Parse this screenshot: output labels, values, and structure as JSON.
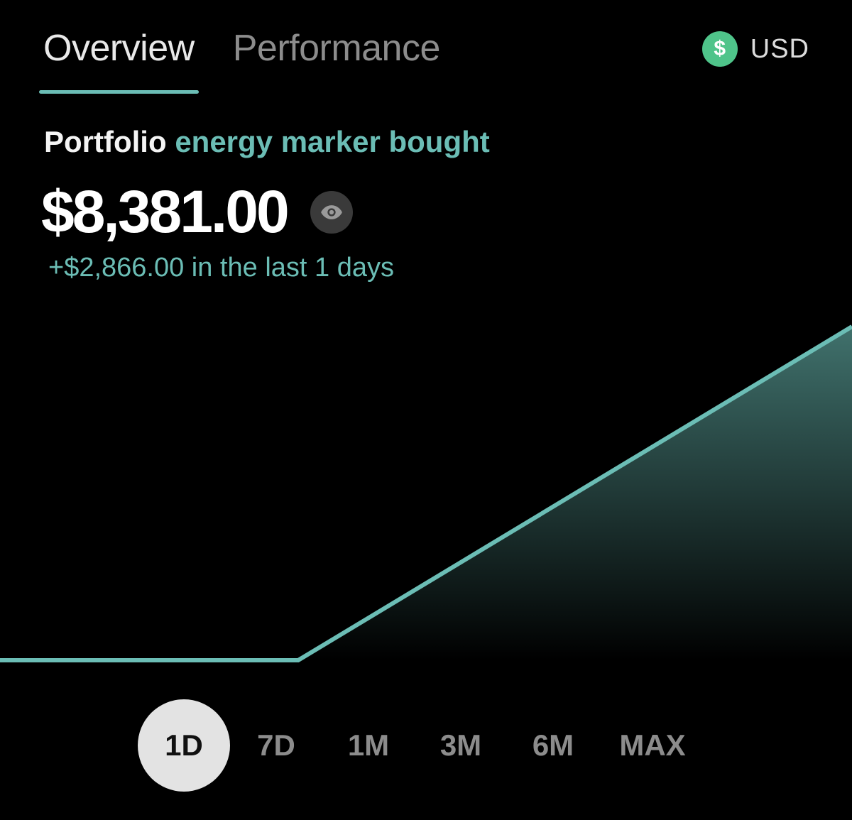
{
  "tabs": [
    {
      "label": "Overview",
      "active": true
    },
    {
      "label": "Performance",
      "active": false
    }
  ],
  "currency": {
    "symbol": "$",
    "code": "USD",
    "icon": "dollar-icon",
    "color": "#4fc48a"
  },
  "headline": {
    "prefix": "Portfolio",
    "highlight": "energy marker bought"
  },
  "balance": {
    "value": "$8,381.00",
    "visibility_icon": "eye-icon"
  },
  "change": {
    "text": "+$2,866.00 in the last 1 days"
  },
  "colors": {
    "accent": "#6bbdb5",
    "background": "#000000",
    "selected_range_bg": "#e3e3e3"
  },
  "chart_data": {
    "type": "area",
    "title": "",
    "xlabel": "",
    "ylabel": "",
    "grid": false,
    "x": [
      0,
      0.35,
      1
    ],
    "y": [
      5515,
      5515,
      8381
    ],
    "ylim": [
      5515,
      8381
    ],
    "color": "#6bbdb5"
  },
  "ranges": [
    {
      "label": "1D",
      "selected": true
    },
    {
      "label": "7D",
      "selected": false
    },
    {
      "label": "1M",
      "selected": false
    },
    {
      "label": "3M",
      "selected": false
    },
    {
      "label": "6M",
      "selected": false
    },
    {
      "label": "MAX",
      "selected": false
    }
  ]
}
